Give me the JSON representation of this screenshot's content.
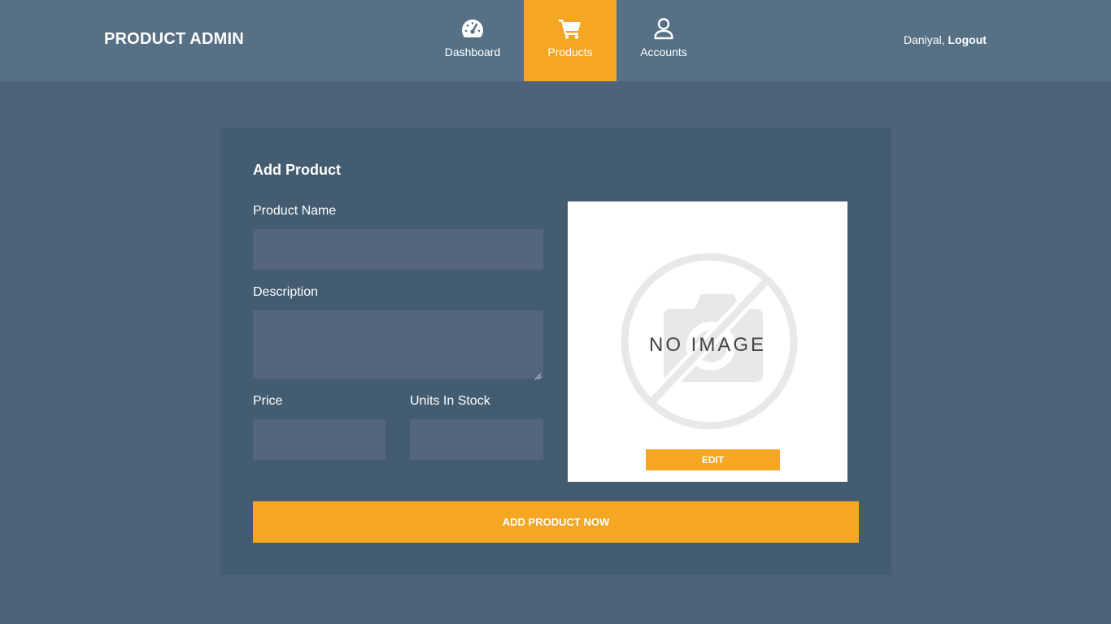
{
  "header": {
    "brand": "PRODUCT ADMIN",
    "nav": {
      "dashboard": {
        "label": "Dashboard",
        "icon": "tachometer-icon"
      },
      "products": {
        "label": "Products",
        "icon": "shopping-cart-icon",
        "active": true
      },
      "accounts": {
        "label": "Accounts",
        "icon": "user-icon"
      }
    },
    "user": {
      "name": "Daniyal,",
      "logout_label": "Logout"
    }
  },
  "form": {
    "title": "Add Product",
    "product_name_label": "Product Name",
    "product_name_value": "",
    "description_label": "Description",
    "description_value": "",
    "price_label": "Price",
    "price_value": "",
    "units_in_stock_label": "Units In Stock",
    "units_in_stock_value": "",
    "image": {
      "placeholder_text": "NO IMAGE",
      "edit_label": "EDIT"
    },
    "submit_label": "ADD PRODUCT NOW"
  },
  "colors": {
    "page_background": "#4e6379",
    "header_background": "#567086",
    "card_background": "#435c70",
    "input_background": "#54657d",
    "accent": "#f5a623"
  }
}
